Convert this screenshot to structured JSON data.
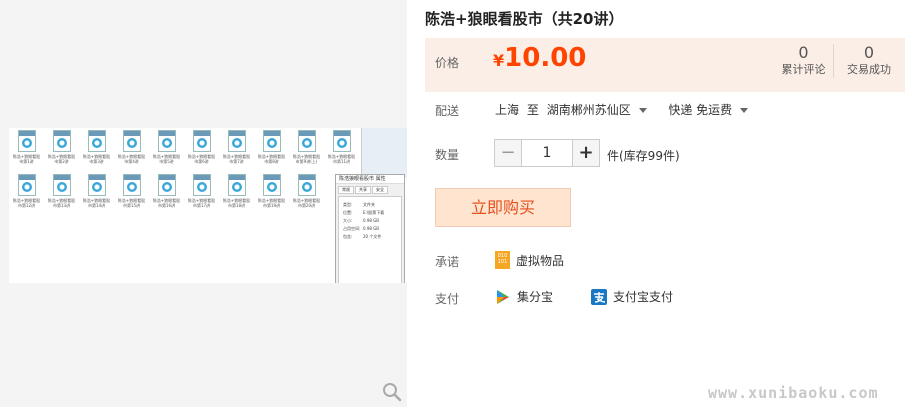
{
  "product": {
    "title": "陈浩+狼眼看股市（共20讲）"
  },
  "price": {
    "label": "价格",
    "currency": "¥",
    "value": "10.00",
    "color": "#ff4400"
  },
  "stats": [
    {
      "value": "0",
      "label": "累计评论"
    },
    {
      "value": "0",
      "label": "交易成功"
    }
  ],
  "shipping": {
    "label": "配送",
    "from": "上海",
    "to_word": "至",
    "destination": "湖南郴州苏仙区",
    "method": "快递 免运费"
  },
  "quantity": {
    "label": "数量",
    "minus": "−",
    "value": "1",
    "plus": "+",
    "stock": "件(库存99件)"
  },
  "buy_button": {
    "label": "立即购买"
  },
  "promise": {
    "label": "承诺",
    "icon_text": "010 101",
    "text": "虚拟物品"
  },
  "payment": {
    "label": "支付",
    "methods": [
      "集分宝",
      "支付宝支付"
    ]
  },
  "gallery": {
    "files": [
      "陈浩+狼眼看股市第1讲",
      "陈浩+狼眼看股市第2讲",
      "陈浩+狼眼看股市第3讲",
      "陈浩+狼眼看股市第4讲",
      "陈浩+狼眼看股市第5讲",
      "陈浩+狼眼看股市第6讲",
      "陈浩+狼眼看股市第7讲",
      "陈浩+狼眼看股市第8讲",
      "陈浩+狼眼看股市第9讲(上)",
      "陈浩+狼眼看股市第11讲",
      "陈浩+狼眼看股市第12讲",
      "陈浩+狼眼看股市第13讲",
      "陈浩+狼眼看股市第14讲",
      "陈浩+狼眼看股市第15讲",
      "陈浩+狼眼看股市第16讲",
      "陈浩+狼眼看股市第17讲",
      "陈浩+狼眼看股市第18讲",
      "陈浩+狼眼看股市第19讲",
      "陈浩+狼眼看股市第20讲"
    ],
    "dialog_title": "陈浩狼眼看股市 属性",
    "dialog_tabs": [
      "常规",
      "共享",
      "安全"
    ],
    "dialog_rows": [
      {
        "k": "类型:",
        "v": "文件夹"
      },
      {
        "k": "位置:",
        "v": "E:\\股票下载"
      },
      {
        "k": "大小:",
        "v": "0.98 GB"
      },
      {
        "k": "占用空间:",
        "v": "0.98 GB"
      },
      {
        "k": "包含:",
        "v": "20 个文件"
      }
    ]
  },
  "watermark": "www.xunibaoku.com"
}
